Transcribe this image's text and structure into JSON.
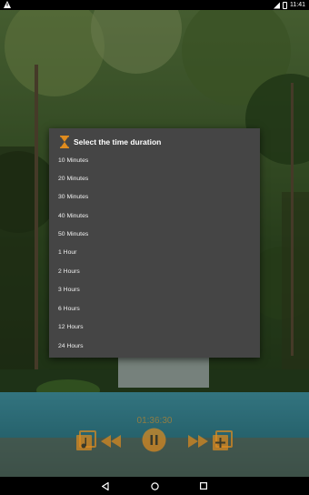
{
  "status_bar": {
    "time": "11:41",
    "icons": [
      "warning-icon",
      "signal-icon",
      "battery-icon"
    ]
  },
  "dialog": {
    "title": "Select the time duration",
    "icon": "hourglass-icon",
    "options": [
      {
        "label": "10 Minutes"
      },
      {
        "label": "20 Minutes"
      },
      {
        "label": "30 Minutes"
      },
      {
        "label": "40 Minutes"
      },
      {
        "label": "50 Minutes"
      },
      {
        "label": "1 Hour"
      },
      {
        "label": "2 Hours"
      },
      {
        "label": "3 Hours"
      },
      {
        "label": "6 Hours"
      },
      {
        "label": "12 Hours"
      },
      {
        "label": "24 Hours"
      }
    ]
  },
  "player": {
    "time": "01:36:30",
    "controls": [
      "playlist-icon",
      "rewind-icon",
      "pause-icon",
      "fast-forward-icon",
      "add-playlist-icon"
    ]
  },
  "nav_bar": {
    "buttons": [
      "back-icon",
      "home-icon",
      "recents-icon"
    ]
  },
  "colors": {
    "dialog_bg": "#454545",
    "accent": "#e08c1e",
    "text": "#ffffff"
  }
}
